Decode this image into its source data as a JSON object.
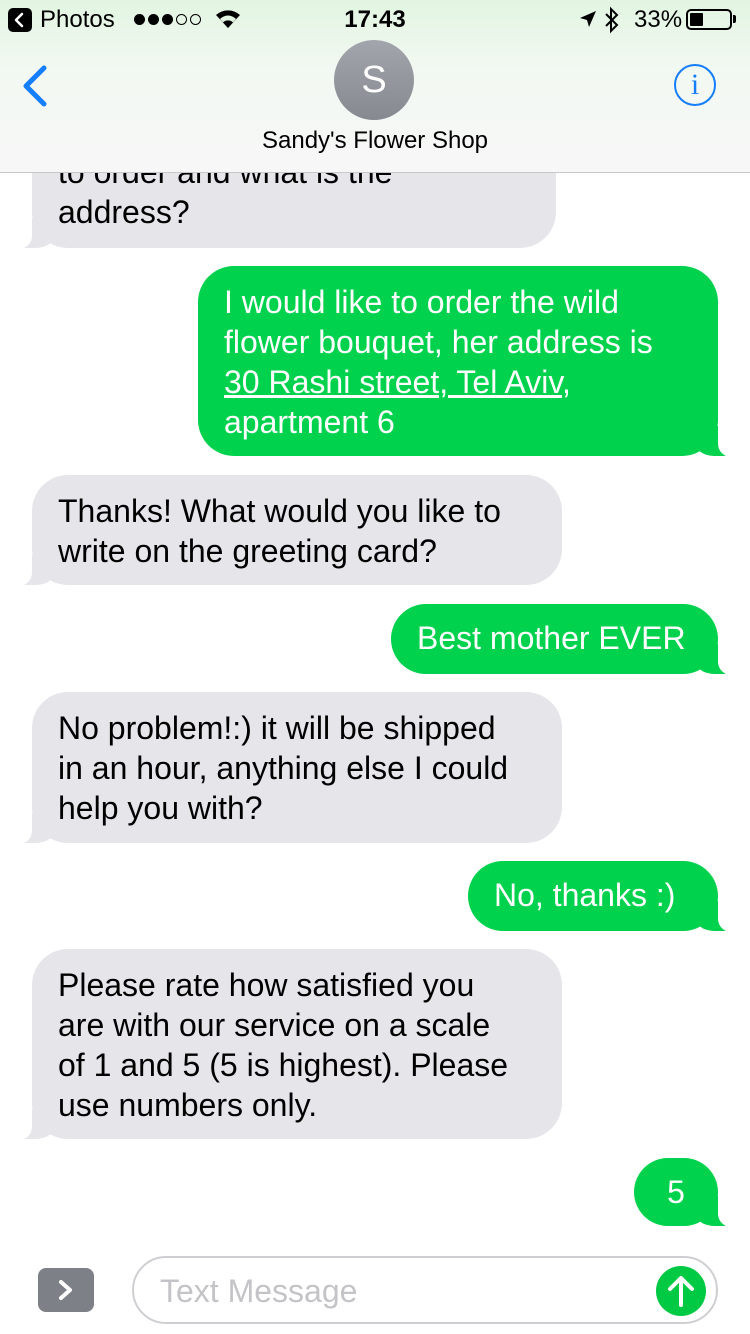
{
  "status_bar": {
    "back_app": "Photos",
    "time": "17:43",
    "battery": "33%",
    "battery_level": 0.33
  },
  "header": {
    "avatar_initial": "S",
    "contact_name": "Sandy's Flower Shop",
    "info_symbol": "i",
    "back_icon": "chevron-left-icon",
    "accent_color": "#157efb"
  },
  "messages": [
    {
      "from": "shop",
      "lines": [
        "to order and what is the",
        "address?"
      ]
    },
    {
      "from": "me",
      "lines": [
        "I would like to order the wild",
        "flower bouquet, her address is"
      ],
      "link": "30 Rashi street, Tel Aviv",
      "after_link": ",",
      "tail": "apartment 6"
    },
    {
      "from": "shop",
      "lines": [
        "Thanks! What would you like to",
        "write on the greeting card?"
      ]
    },
    {
      "from": "me",
      "lines": [
        "Best mother EVER"
      ]
    },
    {
      "from": "shop",
      "lines": [
        "No problem!:) it will be shipped",
        "in an hour, anything else I could",
        "help you with?"
      ]
    },
    {
      "from": "me",
      "lines": [
        "No, thanks :)"
      ]
    },
    {
      "from": "shop",
      "lines": [
        "Please rate how satisfied you",
        "are with our service on a scale",
        "of 1 and 5 (5 is highest). Please",
        "use numbers only."
      ]
    },
    {
      "from": "me",
      "lines": [
        "5"
      ]
    }
  ],
  "colors": {
    "outgoing_bubble": "#00d24d",
    "incoming_bubble": "#e5e5ea",
    "send_button": "#00c943"
  },
  "composer": {
    "placeholder": "Text Message",
    "value": "",
    "send_icon": "arrow-up-icon",
    "expand_icon": "chevron-right-icon"
  }
}
